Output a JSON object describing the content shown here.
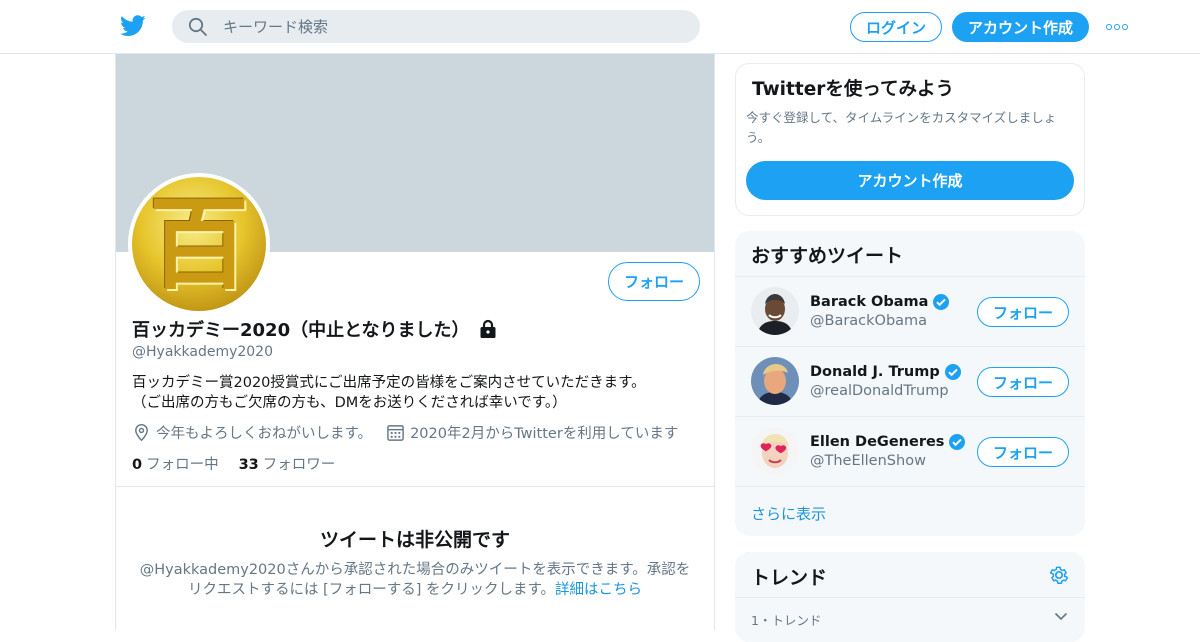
{
  "topbar": {
    "search_placeholder": "キーワード検索",
    "login_label": "ログイン",
    "signup_label": "アカウント作成",
    "brand_color": "#1da1f2"
  },
  "profile": {
    "avatar_glyph": "百",
    "follow_label": "フォロー",
    "name": "百ッカデミー2020（中止となりました）",
    "handle": "@Hyakkademy2020",
    "bio_line1": "百ッカデミー賞2020授賞式にご出席予定の皆様をご案内させていただきます。",
    "bio_line2": "（ご出席の方もご欠席の方も、DMをお送りくだされば幸いです。）",
    "location": "今年もよろしくおねがいします。",
    "joined": "2020年2月からTwitterを利用しています",
    "following_count": "0",
    "following_label": "フォロー中",
    "followers_count": "33",
    "followers_label": "フォロワー",
    "private_title": "ツイートは非公開です",
    "private_desc": "@Hyakkademy2020さんから承認された場合のみツイートを表示できます。承認をリクエストするには [フォローする] をクリックします。",
    "private_link": "詳細はこちら"
  },
  "try_card": {
    "title": "Twitterを使ってみよう",
    "desc": "今すぐ登録して、タイムラインをカスタマイズしましょう。",
    "button": "アカウント作成"
  },
  "recommend": {
    "title": "おすすめツイート",
    "items": [
      {
        "name": "Barack Obama",
        "handle": "@BarackObama",
        "follow": "フォロー"
      },
      {
        "name": "Donald J. Trump",
        "handle": "@realDonaldTrump",
        "follow": "フォロー"
      },
      {
        "name": "Ellen DeGeneres",
        "handle": "@TheEllenShow",
        "follow": "フォロー"
      }
    ],
    "show_more": "さらに表示"
  },
  "trends": {
    "title": "トレンド",
    "first_item": "1・トレンド"
  }
}
